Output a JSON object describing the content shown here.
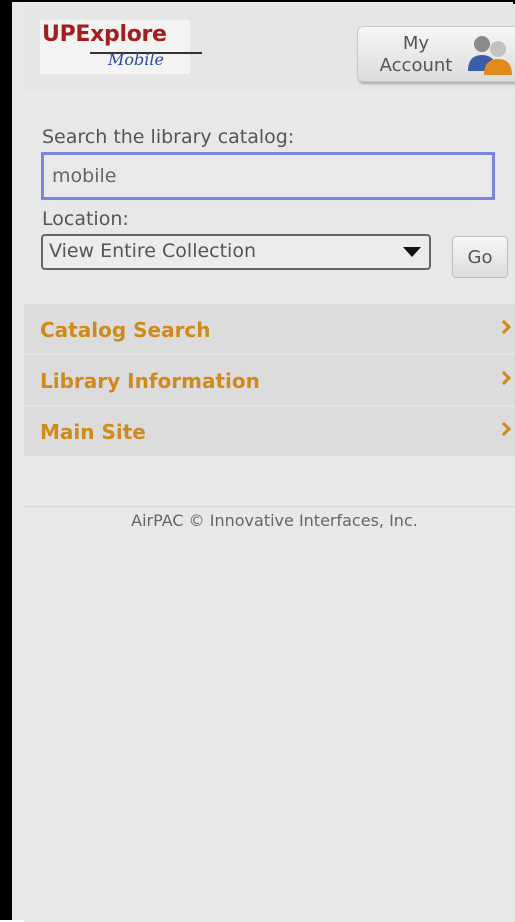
{
  "header": {
    "logo": {
      "main": "UPExplore",
      "sub": "Mobile"
    },
    "account_button": {
      "label": "My\nAccount",
      "icon": "people-icon"
    }
  },
  "search": {
    "label": "Search the library catalog:",
    "value": "mobile",
    "location_label": "Location:",
    "location_selected": "View Entire Collection",
    "go_label": "Go"
  },
  "menu": {
    "items": [
      {
        "label": "Catalog Search"
      },
      {
        "label": "Library Information"
      },
      {
        "label": "Main Site"
      }
    ]
  },
  "footer": {
    "text": "AirPAC © Innovative Interfaces, Inc."
  },
  "colors": {
    "accent": "#d08a1c",
    "logo_red": "#a31f1f",
    "logo_blue": "#2a4aa0",
    "focus_border": "#7b85dc"
  }
}
